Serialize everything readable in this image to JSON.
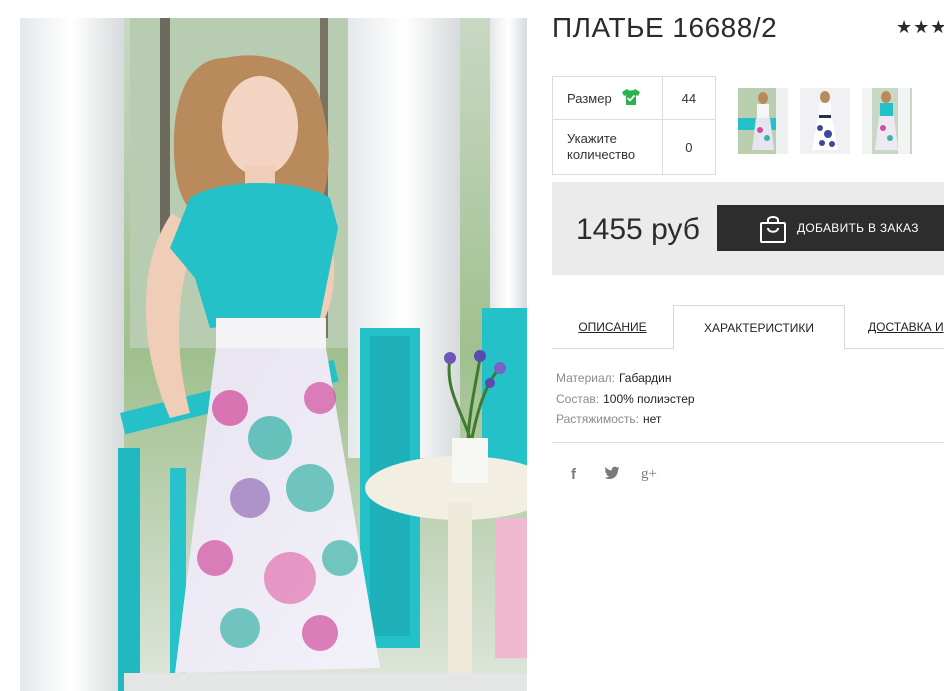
{
  "product": {
    "title": "ПЛАТЬЕ 16688/2",
    "rating_stars": "★★★"
  },
  "options": {
    "size_label": "Размер",
    "size_value": "44",
    "qty_label_line1": "Укажите",
    "qty_label_line2": "количество",
    "qty_value": "0"
  },
  "icons": {
    "size_check": "tshirt-check-icon",
    "bag": "shopping-bag-icon",
    "facebook": "facebook-icon",
    "twitter": "twitter-icon",
    "googleplus": "google-plus-icon"
  },
  "price": {
    "text": "1455 руб",
    "button_label": "ДОБАВИТЬ В ЗАКАЗ"
  },
  "tabs": [
    {
      "label": "ОПИСАНИЕ"
    },
    {
      "label": "ХАРАКТЕРИСТИКИ"
    },
    {
      "label": "ДОСТАВКА И"
    }
  ],
  "characteristics": [
    {
      "key": "Материал:",
      "value": "Габардин"
    },
    {
      "key": "Состав:",
      "value": "100% полиэстер"
    },
    {
      "key": "Растяжимость:",
      "value": "нет"
    }
  ],
  "social": {
    "facebook_glyph": "f",
    "twitter_glyph": "ᵯ",
    "googleplus_glyph": "g+"
  },
  "colors": {
    "accent_teal": "#25c1c9",
    "check_green": "#2bb24c",
    "button_dark": "#2d2d2d",
    "pricebox_bg": "#ebebeb"
  }
}
